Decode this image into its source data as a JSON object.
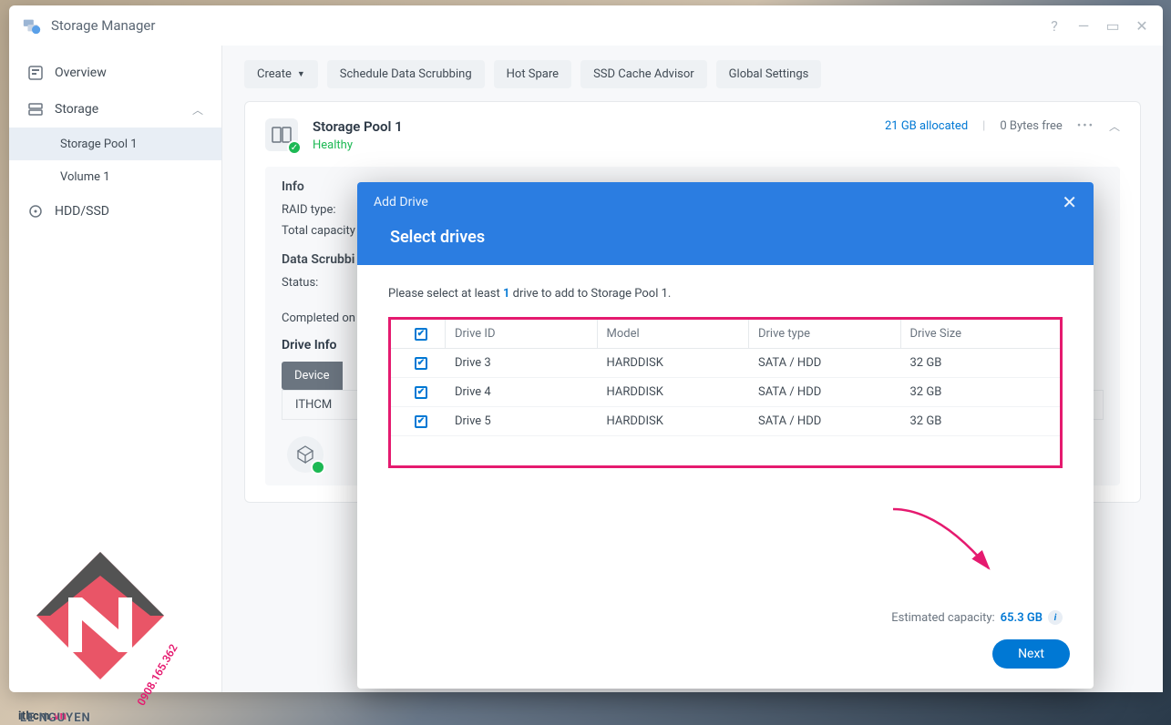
{
  "window": {
    "title": "Storage Manager"
  },
  "sidebar": {
    "overview": "Overview",
    "storage": "Storage",
    "storage_children": [
      {
        "label": "Storage Pool 1"
      },
      {
        "label": "Volume 1"
      }
    ],
    "hdd": "HDD/SSD"
  },
  "toolbar": {
    "create": "Create",
    "scrub": "Schedule Data Scrubbing",
    "hotspare": "Hot Spare",
    "ssd": "SSD Cache Advisor",
    "global": "Global Settings"
  },
  "pool": {
    "name": "Storage Pool 1",
    "status": "Healthy",
    "allocated": "21 GB allocated",
    "free": "0 Bytes free",
    "info_hdr": "Info",
    "raid_label": "RAID type:",
    "capacity_label": "Total capacity",
    "scrub_hdr": "Data Scrubbi",
    "status_label": "Status:",
    "completed_label": "Completed on",
    "drive_info_hdr": "Drive Info",
    "device_tab": "Device",
    "strip_row": "ITHCM"
  },
  "modal": {
    "title": "Add Drive",
    "subtitle": "Select drives",
    "hint_pre": "Please select at least ",
    "hint_num": "1",
    "hint_post": " drive to add to Storage Pool 1.",
    "columns": {
      "id": "Drive ID",
      "model": "Model",
      "type": "Drive type",
      "size": "Drive Size"
    },
    "rows": [
      {
        "id": "Drive 3",
        "model": "HARDDISK",
        "type": "SATA / HDD",
        "size": "32 GB"
      },
      {
        "id": "Drive 4",
        "model": "HARDDISK",
        "type": "SATA / HDD",
        "size": "32 GB"
      },
      {
        "id": "Drive 5",
        "model": "HARDDISK",
        "type": "SATA / HDD",
        "size": "32 GB"
      }
    ],
    "cap_label": "Estimated capacity: ",
    "cap_value": "65.3 GB",
    "next": "Next"
  },
  "watermark": {
    "site_pre": "ithcm",
    "site_suf": ".vn",
    "phone": "0908.165.362",
    "name": "LE NGUYEN"
  }
}
